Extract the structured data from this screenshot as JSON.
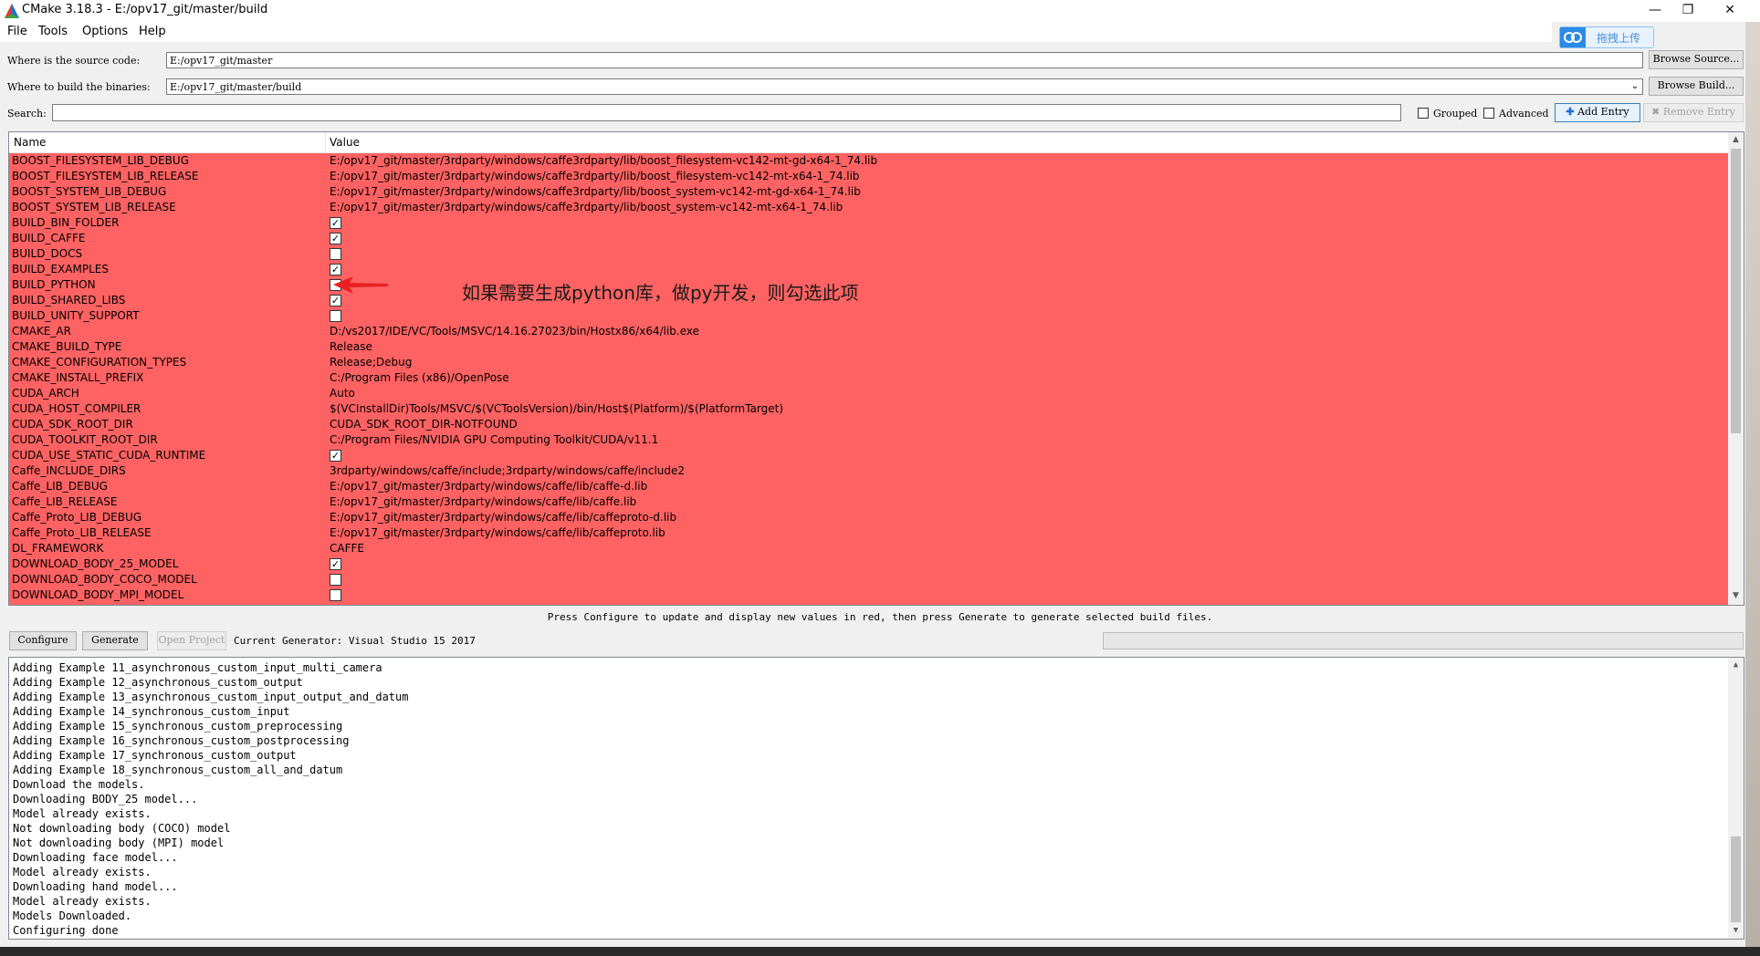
{
  "window": {
    "title": "CMake 3.18.3 - E:/opv17_git/master/build",
    "minimize_glyph": "—",
    "maximize_glyph": "❐",
    "close_glyph": "✕",
    "upload_badge": "拖拽上传"
  },
  "menu": [
    "File",
    "Tools",
    "Options",
    "Help"
  ],
  "paths": {
    "source_label": "Where is the source code:",
    "source_value": "E:/opv17_git/master",
    "browse_source": "Browse Source...",
    "build_label": "Where to build the binaries:",
    "build_value": "E:/opv17_git/master/build",
    "browse_build": "Browse Build..."
  },
  "search": {
    "label": "Search:",
    "value": "",
    "grouped_label": "Grouped",
    "grouped_checked": false,
    "advanced_label": "Advanced",
    "advanced_checked": false,
    "add_entry": "Add Entry",
    "remove_entry": "Remove Entry"
  },
  "table": {
    "columns": [
      "Name",
      "Value"
    ],
    "rows": [
      {
        "name": "BOOST_FILESYSTEM_LIB_DEBUG",
        "type": "text",
        "value": "E:/opv17_git/master/3rdparty/windows/caffe3rdparty/lib/boost_filesystem-vc142-mt-gd-x64-1_74.lib"
      },
      {
        "name": "BOOST_FILESYSTEM_LIB_RELEASE",
        "type": "text",
        "value": "E:/opv17_git/master/3rdparty/windows/caffe3rdparty/lib/boost_filesystem-vc142-mt-x64-1_74.lib"
      },
      {
        "name": "BOOST_SYSTEM_LIB_DEBUG",
        "type": "text",
        "value": "E:/opv17_git/master/3rdparty/windows/caffe3rdparty/lib/boost_system-vc142-mt-gd-x64-1_74.lib"
      },
      {
        "name": "BOOST_SYSTEM_LIB_RELEASE",
        "type": "text",
        "value": "E:/opv17_git/master/3rdparty/windows/caffe3rdparty/lib/boost_system-vc142-mt-x64-1_74.lib"
      },
      {
        "name": "BUILD_BIN_FOLDER",
        "type": "bool",
        "value": true
      },
      {
        "name": "BUILD_CAFFE",
        "type": "bool",
        "value": true
      },
      {
        "name": "BUILD_DOCS",
        "type": "bool",
        "value": false
      },
      {
        "name": "BUILD_EXAMPLES",
        "type": "bool",
        "value": true
      },
      {
        "name": "BUILD_PYTHON",
        "type": "bool",
        "value": false
      },
      {
        "name": "BUILD_SHARED_LIBS",
        "type": "bool",
        "value": true
      },
      {
        "name": "BUILD_UNITY_SUPPORT",
        "type": "bool",
        "value": false
      },
      {
        "name": "CMAKE_AR",
        "type": "text",
        "value": "D:/vs2017/IDE/VC/Tools/MSVC/14.16.27023/bin/Hostx86/x64/lib.exe"
      },
      {
        "name": "CMAKE_BUILD_TYPE",
        "type": "text",
        "value": "Release"
      },
      {
        "name": "CMAKE_CONFIGURATION_TYPES",
        "type": "text",
        "value": "Release;Debug"
      },
      {
        "name": "CMAKE_INSTALL_PREFIX",
        "type": "text",
        "value": "C:/Program Files (x86)/OpenPose"
      },
      {
        "name": "CUDA_ARCH",
        "type": "text",
        "value": "Auto"
      },
      {
        "name": "CUDA_HOST_COMPILER",
        "type": "text",
        "value": "$(VCInstallDir)Tools/MSVC/$(VCToolsVersion)/bin/Host$(Platform)/$(PlatformTarget)"
      },
      {
        "name": "CUDA_SDK_ROOT_DIR",
        "type": "text",
        "value": "CUDA_SDK_ROOT_DIR-NOTFOUND"
      },
      {
        "name": "CUDA_TOOLKIT_ROOT_DIR",
        "type": "text",
        "value": "C:/Program Files/NVIDIA GPU Computing Toolkit/CUDA/v11.1"
      },
      {
        "name": "CUDA_USE_STATIC_CUDA_RUNTIME",
        "type": "bool",
        "value": true
      },
      {
        "name": "Caffe_INCLUDE_DIRS",
        "type": "text",
        "value": "3rdparty/windows/caffe/include;3rdparty/windows/caffe/include2"
      },
      {
        "name": "Caffe_LIB_DEBUG",
        "type": "text",
        "value": "E:/opv17_git/master/3rdparty/windows/caffe/lib/caffe-d.lib"
      },
      {
        "name": "Caffe_LIB_RELEASE",
        "type": "text",
        "value": "E:/opv17_git/master/3rdparty/windows/caffe/lib/caffe.lib"
      },
      {
        "name": "Caffe_Proto_LIB_DEBUG",
        "type": "text",
        "value": "E:/opv17_git/master/3rdparty/windows/caffe/lib/caffeproto-d.lib"
      },
      {
        "name": "Caffe_Proto_LIB_RELEASE",
        "type": "text",
        "value": "E:/opv17_git/master/3rdparty/windows/caffe/lib/caffeproto.lib"
      },
      {
        "name": "DL_FRAMEWORK",
        "type": "text",
        "value": "CAFFE"
      },
      {
        "name": "DOWNLOAD_BODY_25_MODEL",
        "type": "bool",
        "value": true
      },
      {
        "name": "DOWNLOAD_BODY_COCO_MODEL",
        "type": "bool",
        "value": false
      },
      {
        "name": "DOWNLOAD_BODY_MPI_MODEL",
        "type": "bool",
        "value": false
      }
    ]
  },
  "annotation": "如果需要生成python库，做py开发，则勾选此项",
  "hint": "Press Configure to update and display new values in red, then press Generate to generate selected build files.",
  "actions": {
    "configure": "Configure",
    "generate": "Generate",
    "open_project": "Open Project",
    "generator": "Current Generator: Visual Studio 15 2017"
  },
  "log": [
    "Adding Example 11_asynchronous_custom_input_multi_camera",
    "Adding Example 12_asynchronous_custom_output",
    "Adding Example 13_asynchronous_custom_input_output_and_datum",
    "Adding Example 14_synchronous_custom_input",
    "Adding Example 15_synchronous_custom_preprocessing",
    "Adding Example 16_synchronous_custom_postprocessing",
    "Adding Example 17_synchronous_custom_output",
    "Adding Example 18_synchronous_custom_all_and_datum",
    "Download the models.",
    "Downloading BODY_25 model...",
    "Model already exists.",
    "Not downloading body (COCO) model",
    "Not downloading body (MPI) model",
    "Downloading face model...",
    "Model already exists.",
    "Downloading hand model...",
    "Model already exists.",
    "Models Downloaded.",
    "Configuring done"
  ],
  "colors": {
    "changed_row": "#ff6262",
    "accent": "#2b8ae6"
  }
}
